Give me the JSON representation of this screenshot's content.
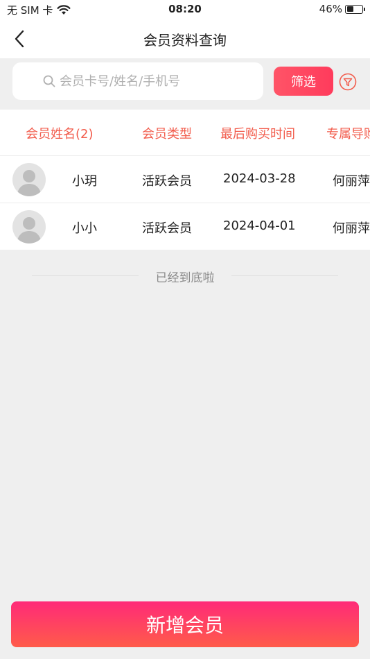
{
  "status_bar": {
    "carrier": "无 SIM 卡",
    "time": "08:20",
    "battery_text": "46%",
    "battery_level": 0.46
  },
  "nav": {
    "title": "会员资料查询"
  },
  "search": {
    "placeholder": "会员卡号/姓名/手机号",
    "value": ""
  },
  "filter": {
    "label": "筛选"
  },
  "table": {
    "headers": [
      "会员姓名(2)",
      "会员类型",
      "最后购买时间",
      "专属导购"
    ],
    "rows": [
      {
        "name": "小玥",
        "type": "活跃会员",
        "last_purchase": "2024-03-28",
        "guide": "何丽萍"
      },
      {
        "name": "小小",
        "type": "活跃会员",
        "last_purchase": "2024-04-01",
        "guide": "何丽萍"
      }
    ]
  },
  "end_note": "已经到底啦",
  "add_button": {
    "label": "新增会员"
  },
  "colors": {
    "accent": "#f25c4c",
    "filter_button": "#ff4a62",
    "add_button_top": "#ff2a78",
    "add_button_bottom": "#ff5b4a"
  }
}
